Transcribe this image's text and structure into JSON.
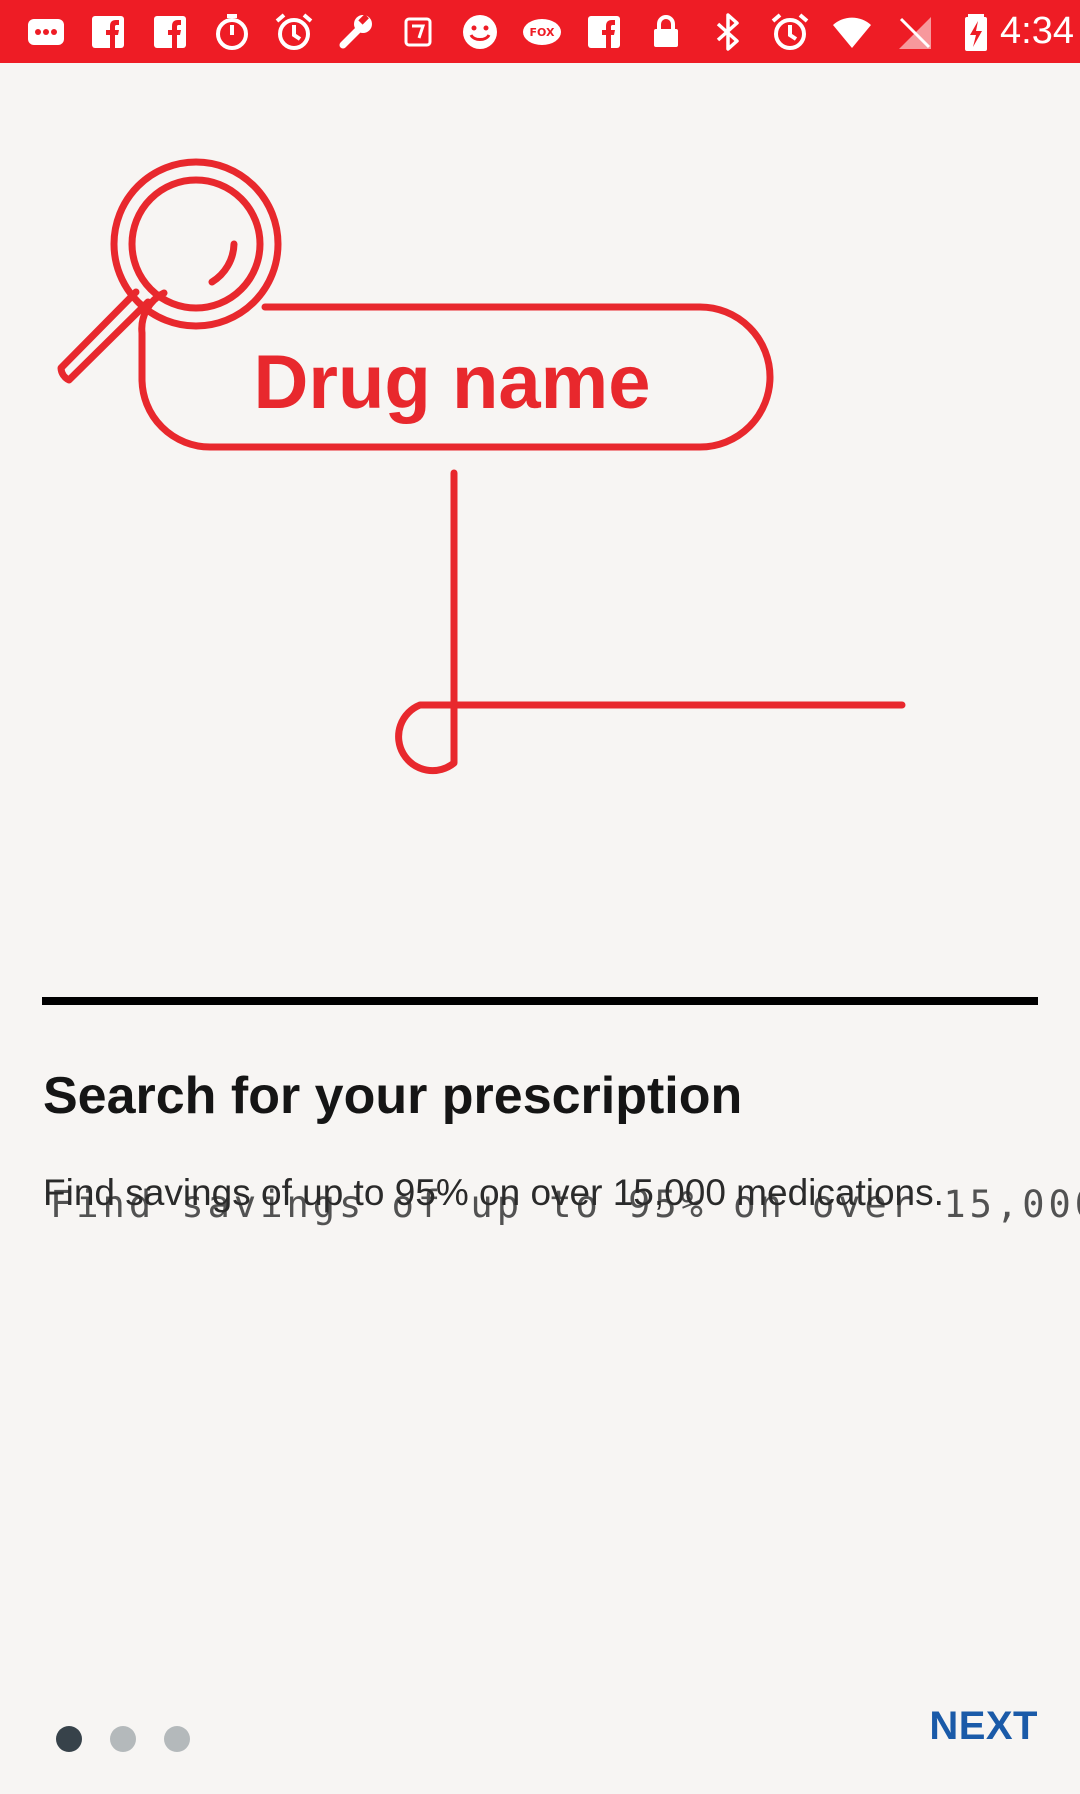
{
  "status_bar": {
    "time": "4:34",
    "background_color": "#ee1c25",
    "icons": [
      "messages-icon",
      "facebook-icon",
      "facebook-icon",
      "stopwatch-icon",
      "alarm-icon",
      "wrench-icon",
      "tag-icon",
      "smiley-icon",
      "fox-sports-icon",
      "facebook-icon",
      "lock-icon",
      "bluetooth-icon",
      "alarm-icon",
      "wifi-icon",
      "no-sim-icon",
      "battery-charging-icon"
    ]
  },
  "illustration": {
    "label": "Drug name",
    "color": "#e8282d"
  },
  "content": {
    "title": "Search for your prescription",
    "subtitle": "Find savings of up to 95% on over 15,000 medications."
  },
  "pager": {
    "count": 3,
    "active_index": 0,
    "active_color": "#37424a",
    "inactive_color": "#b4b9bb"
  },
  "actions": {
    "next_label": "NEXT",
    "next_color": "#1a5aa8"
  }
}
